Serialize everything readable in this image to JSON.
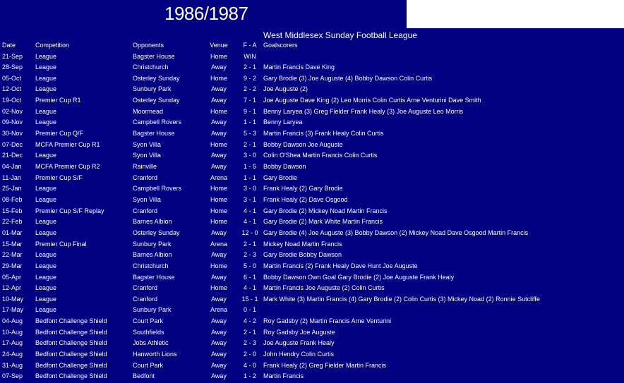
{
  "season": "1986/1987",
  "league": "West Middlesex Sunday Football League",
  "columns": {
    "date": "Date",
    "competition": "Competition",
    "opponents": "Opponents",
    "venue": "Venue",
    "score": "F - A",
    "goalscorers": "Goalscorers"
  },
  "matches": [
    {
      "date": "21-Sep",
      "competition": "League",
      "opponents": "Bagster House",
      "venue": "Home",
      "score": "WIN",
      "goalscorers": ""
    },
    {
      "date": "28-Sep",
      "competition": "League",
      "opponents": "Christchurch",
      "venue": "Away",
      "score": "2 - 1",
      "goalscorers": "Martin Francis Dave King"
    },
    {
      "date": "05-Oct",
      "competition": "League",
      "opponents": "Osterley Sunday",
      "venue": "Home",
      "score": "9 - 2",
      "goalscorers": "Gary Brodie (3) Joe Auguste (4) Bobby Dawson Colin Curtis"
    },
    {
      "date": "12-Oct",
      "competition": "League",
      "opponents": "Sunbury Park",
      "venue": "Away",
      "score": "2 - 2",
      "goalscorers": "Joe Auguste (2)"
    },
    {
      "date": "19-Oct",
      "competition": "Premier Cup R1",
      "opponents": "Osterley Sunday",
      "venue": "Away",
      "score": "7 - 1",
      "goalscorers": "Joe Auguste Dave King (2) Leo Morris Colin Curtis Arne Venturini Dave Smith"
    },
    {
      "date": "02-Nov",
      "competition": "League",
      "opponents": "Moormead",
      "venue": "Home",
      "score": "9 - 1",
      "goalscorers": "Benny Laryea (3) Greg Fielder Frank Healy (3) Joe Auguste Leo Morris"
    },
    {
      "date": "09-Nov",
      "competition": "League",
      "opponents": "Campbell Rovers",
      "venue": "Away",
      "score": "1 - 1",
      "goalscorers": "Benny Laryea"
    },
    {
      "date": "30-Nov",
      "competition": "Premier Cup Q/F",
      "opponents": "Bagster House",
      "venue": "Away",
      "score": "5 - 3",
      "goalscorers": "Martin Francis (3) Frank Healy  Colin Curtis"
    },
    {
      "date": "07-Dec",
      "competition": "MCFA Premier Cup R1",
      "opponents": "Syon Villa",
      "venue": "Home",
      "score": "2 - 1",
      "goalscorers": "Bobby Dawson Joe Auguste"
    },
    {
      "date": "21-Dec",
      "competition": "League",
      "opponents": "Syon Villa",
      "venue": "Away",
      "score": "3 - 0",
      "goalscorers": "Colin O'Shea Martin Francis Colin Curtis"
    },
    {
      "date": "04-Jan",
      "competition": "MCFA Premier Cup R2",
      "opponents": "Rainville",
      "venue": "Away",
      "score": "1 - 5",
      "goalscorers": "Bobby Dawson"
    },
    {
      "date": "11-Jan",
      "competition": "Premier Cup S/F",
      "opponents": "Cranford",
      "venue": "Arena",
      "score": "1 - 1",
      "goalscorers": "Gary Brodie"
    },
    {
      "date": "25-Jan",
      "competition": "League",
      "opponents": "Campbell Rovers",
      "venue": "Home",
      "score": "3 - 0",
      "goalscorers": "Frank Healy (2)  Gary Brodie"
    },
    {
      "date": "08-Feb",
      "competition": "League",
      "opponents": "Syon Villa",
      "venue": "Home",
      "score": "3 - 1",
      "goalscorers": "Frank Healy (2)  Dave Osgood"
    },
    {
      "date": "15-Feb",
      "competition": "Premier Cup S/F Replay",
      "opponents": "Cranford",
      "venue": "Home",
      "score": "4 - 1",
      "goalscorers": "Gary Brodie (2)  Mickey Noad  Martin Francis"
    },
    {
      "date": "22-Feb",
      "competition": "League",
      "opponents": "Barnes Albion",
      "venue": "Home",
      "score": "4 - 1",
      "goalscorers": "Gary Brodie (2) Mark White Martin Francis"
    },
    {
      "date": "01-Mar",
      "competition": "League",
      "opponents": "Osterley Sunday",
      "venue": "Away",
      "score": "12 - 0",
      "goalscorers": "Gary Brodie (4) Joe Auguste (3) Bobby Dawson (2) Mickey Noad Dave Osgood Martin Francis"
    },
    {
      "date": "15-Mar",
      "competition": "Premier Cup Final",
      "opponents": "Sunbury Park",
      "venue": "Arena",
      "score": "2 - 1",
      "goalscorers": "Mickey Noad  Martin Francis"
    },
    {
      "date": "22-Mar",
      "competition": "League",
      "opponents": "Barnes Albion",
      "venue": "Away",
      "score": "2 - 3",
      "goalscorers": "Gary Brodie Bobby Dawson"
    },
    {
      "date": "29-Mar",
      "competition": "League",
      "opponents": "Christchurch",
      "venue": "Home",
      "score": "5 - 0",
      "goalscorers": "Martin Francis (2) Frank Healy Dave Hunt Joe Auguste"
    },
    {
      "date": "05-Apr",
      "competition": "League",
      "opponents": "Bagster House",
      "venue": "Away",
      "score": "6 - 1",
      "goalscorers": "Bobby Dawson  Own Goal  Gary Brodie (2)  Joe Auguste Frank Healy"
    },
    {
      "date": "12-Apr",
      "competition": "League",
      "opponents": "Cranford",
      "venue": "Home",
      "score": "4 - 1",
      "goalscorers": "Martin Francis Joe Auguste (2) Colin Curtis"
    },
    {
      "date": "10-May",
      "competition": "League",
      "opponents": "Cranford",
      "venue": "Away",
      "score": "15 - 1",
      "goalscorers": "Mark White (3) Martin Francis (4) Gary Brodie (2) Colin Curtis (3) Mickey Noad (2) Ronnie Sutcliffe"
    },
    {
      "date": "17-May",
      "competition": "League",
      "opponents": "Sunbury Park",
      "venue": "Arena",
      "score": "0 - 1",
      "goalscorers": ""
    },
    {
      "date": "04-Aug",
      "competition": "Bedfont Challenge Shield",
      "opponents": "Court Park",
      "venue": "Away",
      "score": "4 - 2",
      "goalscorers": "Roy Gadsby (2) Martin Francis Arne Venturini"
    },
    {
      "date": "10-Aug",
      "competition": "Bedfont Challenge Shield",
      "opponents": "Southfields",
      "venue": "Away",
      "score": "2 - 1",
      "goalscorers": "Roy Gadsby  Joe Auguste"
    },
    {
      "date": "17-Aug",
      "competition": "Bedfont Challenge Shield",
      "opponents": "Jobs Athletic",
      "venue": "Away",
      "score": "2 - 3",
      "goalscorers": "Joe Auguste  Frank Healy"
    },
    {
      "date": "24-Aug",
      "competition": "Bedfont Challenge Shield",
      "opponents": "Hanworth Lions",
      "venue": "Away",
      "score": "2 - 0",
      "goalscorers": "John Hendry  Colin Curtis"
    },
    {
      "date": "31-Aug",
      "competition": "Bedfont Challenge Shield",
      "opponents": "Court Park",
      "venue": "Away",
      "score": "4 - 0",
      "goalscorers": "Frank Healy (2)  Greg Fielder  Martin Francis"
    },
    {
      "date": "07-Sep",
      "competition": "Bedfont Challenge Shield",
      "opponents": "Bedfont",
      "venue": "Away",
      "score": "1 - 2",
      "goalscorers": "Martin Francis"
    }
  ]
}
